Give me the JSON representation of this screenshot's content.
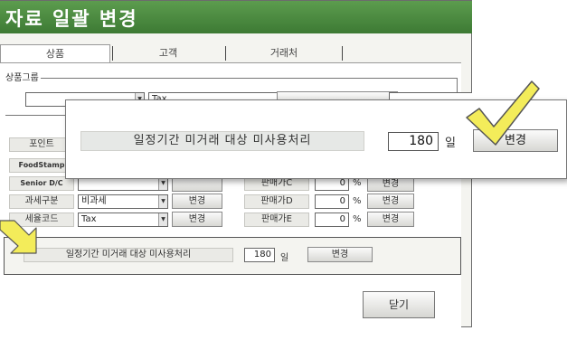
{
  "window": {
    "title": "자료 일괄 변경"
  },
  "tabs": [
    "상품",
    "고객",
    "거래처"
  ],
  "group": {
    "label": "상품그룹",
    "tax_value": "Tax"
  },
  "left_rows": [
    {
      "label": "포인트",
      "value": ""
    },
    {
      "label": "FoodStamp",
      "value": ""
    },
    {
      "label": "Senior D/C",
      "value": ""
    },
    {
      "label": "과세구분",
      "value": "비과세",
      "button": "변경"
    },
    {
      "label": "세율코드",
      "value": "Tax",
      "button": "변경"
    }
  ],
  "right_rows": [
    {
      "label": "판매가C",
      "value": "0",
      "unit": "%",
      "button": "변경"
    },
    {
      "label": "판매가D",
      "value": "0",
      "unit": "%",
      "button": "변경"
    },
    {
      "label": "판매가E",
      "value": "0",
      "unit": "%",
      "button": "변경"
    }
  ],
  "period_row": {
    "label": "일정기간 미거래 대상 미사용처리",
    "value": "180",
    "unit": "일",
    "button": "변경"
  },
  "close_button": "닫기",
  "overlay": {
    "label": "일정기간 미거래 대상 미사용처리",
    "value": "180",
    "unit": "일",
    "button": "변경"
  },
  "colors": {
    "title_green": "#4a8a3f",
    "check_yellow": "#f3ec5a",
    "arrow_yellow": "#f3ec5a"
  }
}
